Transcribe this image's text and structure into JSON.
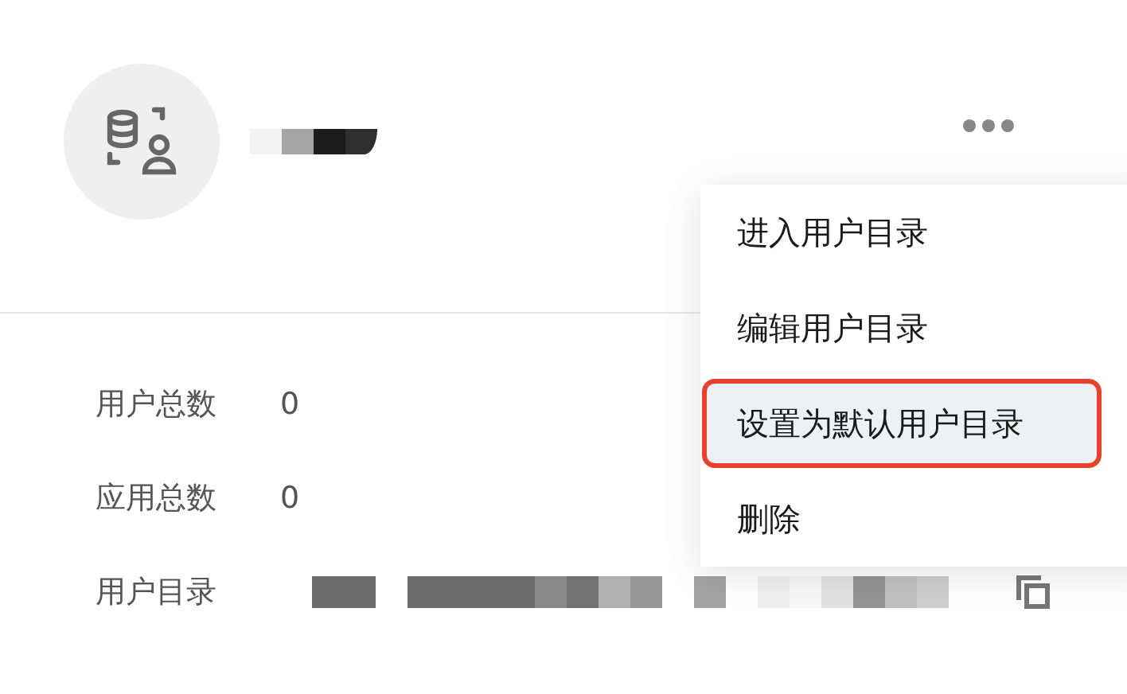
{
  "stats": [
    {
      "label": "用户总数",
      "value": "0"
    },
    {
      "label": "应用总数",
      "value": "0"
    }
  ],
  "directory": {
    "label": "用户目录"
  },
  "menu": [
    {
      "label": "进入用户目录",
      "selected": false
    },
    {
      "label": "编辑用户目录",
      "selected": false
    },
    {
      "label": "设置为默认用户目录",
      "selected": true
    },
    {
      "label": "删除",
      "selected": false
    }
  ]
}
